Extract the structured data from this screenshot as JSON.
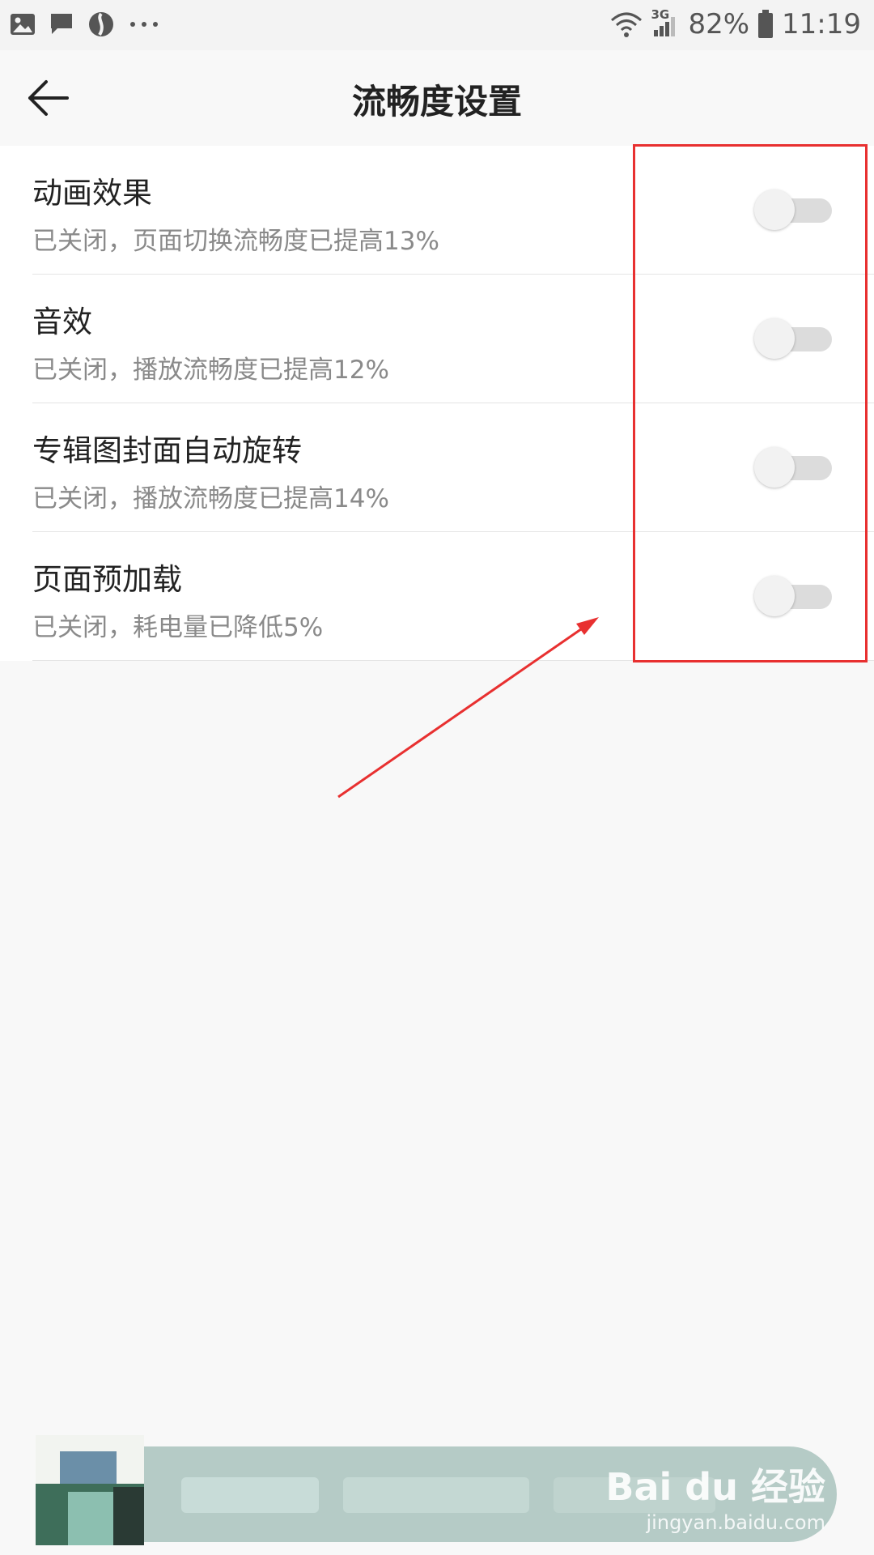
{
  "status_bar": {
    "battery": "82%",
    "time": "11:19",
    "network": "3G",
    "icons": [
      "gallery-icon",
      "message-icon",
      "browser-icon",
      "more-dots-icon",
      "wifi-icon",
      "signal-icon",
      "battery-icon"
    ]
  },
  "header": {
    "title": "流畅度设置",
    "back_icon": "back-arrow-icon"
  },
  "settings": [
    {
      "title": "动画效果",
      "desc": "已关闭，页面切换流畅度已提高13%",
      "enabled": false
    },
    {
      "title": "音效",
      "desc": "已关闭，播放流畅度已提高12%",
      "enabled": false
    },
    {
      "title": "专辑图封面自动旋转",
      "desc": "已关闭，播放流畅度已提高14%",
      "enabled": false
    },
    {
      "title": "页面预加载",
      "desc": "已关闭，耗电量已降低5%",
      "enabled": false
    }
  ],
  "annotation": {
    "highlight_color": "#e83030",
    "arrow_color": "#e83030"
  },
  "player": {
    "bar_color": "#b5cbc6"
  },
  "watermark": {
    "brand": "Bai du 经验",
    "url": "jingyan.baidu.com"
  }
}
